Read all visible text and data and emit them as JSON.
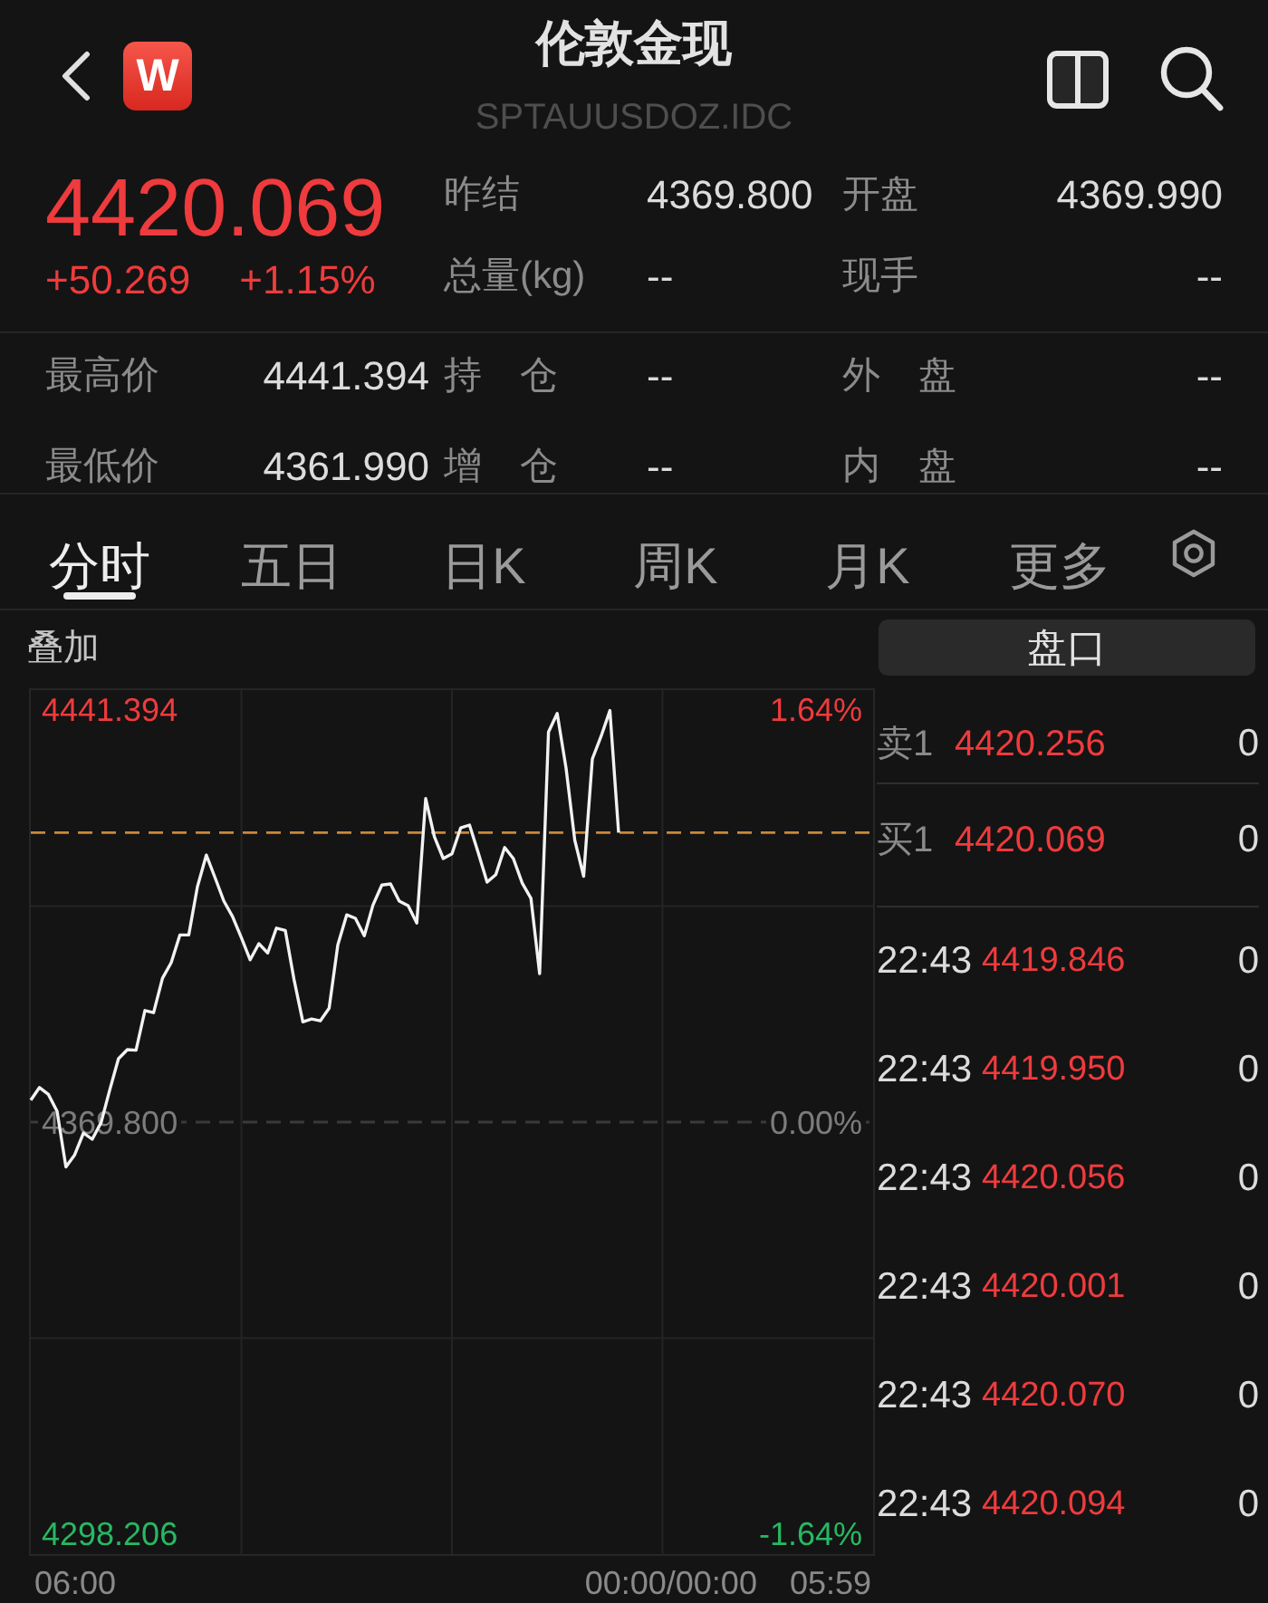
{
  "header": {
    "logo_text": "W",
    "title": "伦敦金现",
    "code": "SPTAUUSDOZ.IDC"
  },
  "quote": {
    "price": "4420.069",
    "change": "+50.269",
    "change_percent": "+1.15%",
    "up": true
  },
  "stats": [
    {
      "label": "昨结",
      "value": "4369.800"
    },
    {
      "label": "开盘",
      "value": "4369.990"
    },
    {
      "label": "总量(kg)",
      "value": "--"
    },
    {
      "label": "现手",
      "value": "--"
    }
  ],
  "details": [
    {
      "label": "最高价",
      "value": "4441.394"
    },
    {
      "label": "持　仓",
      "value": "--"
    },
    {
      "label": "外　盘",
      "value": "--"
    },
    {
      "label": "最低价",
      "value": "4361.990"
    },
    {
      "label": "增　仓",
      "value": "--"
    },
    {
      "label": "内　盘",
      "value": "--"
    }
  ],
  "tabs": [
    {
      "label": "分时",
      "selected": true
    },
    {
      "label": "五日",
      "selected": false
    },
    {
      "label": "日K",
      "selected": false
    },
    {
      "label": "周K",
      "selected": false
    },
    {
      "label": "月K",
      "selected": false
    },
    {
      "label": "更多",
      "selected": false
    }
  ],
  "chart": {
    "overlay_option": "叠加",
    "percent_labels": [
      "1.64%",
      "0.00%",
      "-1.64%"
    ],
    "time_labels": [
      "06:00",
      "00:00/00:00",
      "05:59"
    ],
    "chart_data": {
      "type": "line",
      "grid": true,
      "categories": [
        null,
        null,
        null,
        null,
        null,
        null,
        null,
        null,
        null,
        null,
        null,
        null,
        null,
        null,
        null,
        null,
        null,
        null,
        null,
        null,
        null,
        null,
        null,
        null,
        null,
        null,
        null,
        null,
        null,
        null,
        null,
        null,
        null,
        null,
        null,
        null,
        null,
        null,
        null,
        null,
        null,
        null,
        null,
        null,
        null,
        null,
        null,
        null,
        null,
        null,
        null,
        null,
        null,
        null,
        null,
        null,
        null,
        null,
        null,
        null,
        null,
        null,
        null,
        null,
        null,
        null,
        null,
        null,
        null,
        null,
        null,
        null,
        null,
        null,
        null,
        null,
        null,
        null,
        null,
        null,
        null,
        null,
        null,
        null,
        null,
        null,
        null,
        null,
        null,
        null,
        null,
        null,
        null,
        null,
        null,
        null,
        null
      ],
      "series": [
        {
          "color": "#f2f2f2",
          "values": [
            4373.6,
            4375.8,
            4374.6,
            4371.7,
            4362.0,
            4364.1,
            4367.9,
            4366.8,
            4369.7,
            4375.4,
            4380.8,
            4382.4,
            4382.3,
            4389.2,
            4388.8,
            4394.8,
            4397.5,
            4402.3,
            4402.3,
            4410.7,
            4416.2,
            4412.3,
            4408.2,
            4405.5,
            4401.8,
            4398.0,
            4400.8,
            4399.2,
            4403.5,
            4403.1,
            4394.6,
            4387.2,
            4387.7,
            4387.4,
            4389.6,
            4400.6,
            4405.8,
            4405.2,
            4402.2,
            4407.5,
            4411.0,
            4411.2,
            4408.2,
            4407.4,
            4404.4,
            4426.0,
            4419.4,
            4415.6,
            4416.4,
            4420.9,
            4421.4,
            4416.6,
            4411.5,
            4412.8,
            4417.5,
            4415.6,
            4411.3,
            4408.7,
            4395.6,
            4437.6,
            4440.8,
            4431.3,
            4418.8,
            4412.5,
            4432.9,
            4436.8,
            4441.3,
            4420.1,
            null,
            null,
            null,
            null,
            null,
            null,
            null,
            null,
            null,
            null,
            null,
            null,
            null,
            null,
            null,
            null,
            null,
            null,
            null,
            null,
            null,
            null,
            null,
            null,
            null,
            null,
            null,
            null,
            null
          ]
        }
      ],
      "ylim": [
        4294.74,
        4444.86
      ],
      "yticks": [
        {
          "value": 4441.394,
          "label": "4441.394"
        },
        {
          "value": 4369.8,
          "label": "4369.800"
        },
        {
          "value": 4298.206,
          "label": "4298.206"
        }
      ],
      "ref_lines": [
        {
          "axis": "y",
          "value": 4369.8,
          "color": "#3a3a3a"
        },
        {
          "axis": "y",
          "value": 4420.1,
          "color": "#c9883c"
        }
      ]
    }
  },
  "order_book": {
    "title": "盘口",
    "levels": [
      {
        "label": "卖1",
        "price": "4420.256",
        "volume": "0",
        "up": true
      },
      {
        "label": "买1",
        "price": "4420.069",
        "volume": "0",
        "up": true
      }
    ],
    "trades": [
      {
        "time": "22:43",
        "price": "4419.846",
        "volume": "0",
        "up": true
      },
      {
        "time": "22:43",
        "price": "4419.950",
        "volume": "0",
        "up": true
      },
      {
        "time": "22:43",
        "price": "4420.056",
        "volume": "0",
        "up": true
      },
      {
        "time": "22:43",
        "price": "4420.001",
        "volume": "0",
        "up": true
      },
      {
        "time": "22:43",
        "price": "4420.070",
        "volume": "0",
        "up": true
      },
      {
        "time": "22:43",
        "price": "4420.094",
        "volume": "0",
        "up": true
      }
    ]
  }
}
